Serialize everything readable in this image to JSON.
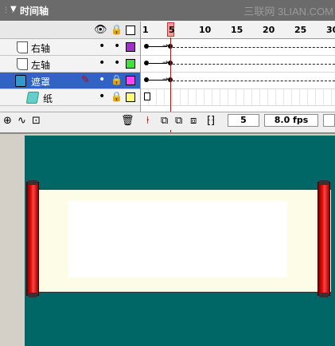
{
  "panel": {
    "title": "时间轴",
    "watermark": "三联网 3LIAN.COM"
  },
  "ruler": {
    "frames": [
      "1",
      "5",
      "10",
      "15",
      "20",
      "25",
      "30"
    ],
    "current": 5
  },
  "layers": [
    {
      "name": "右轴",
      "type": "normal",
      "color": "#a030c8"
    },
    {
      "name": "左轴",
      "type": "normal",
      "color": "#40e040"
    },
    {
      "name": "遮罩",
      "type": "mask",
      "color": "#ff40ff",
      "selected": true
    },
    {
      "name": "纸",
      "type": "masked",
      "color": "#ffff70"
    }
  ],
  "status": {
    "current_frame": "5",
    "frame_rate": "8.0 fps"
  },
  "colors": {
    "stage_bg": "#006666",
    "scroll_paper": "#fdfde7",
    "rod": "#e01010",
    "selection": "#3163c6"
  },
  "icons": [
    "eye-icon",
    "lock-icon",
    "outline-icon",
    "trash-icon",
    "onion-skin-icon"
  ]
}
